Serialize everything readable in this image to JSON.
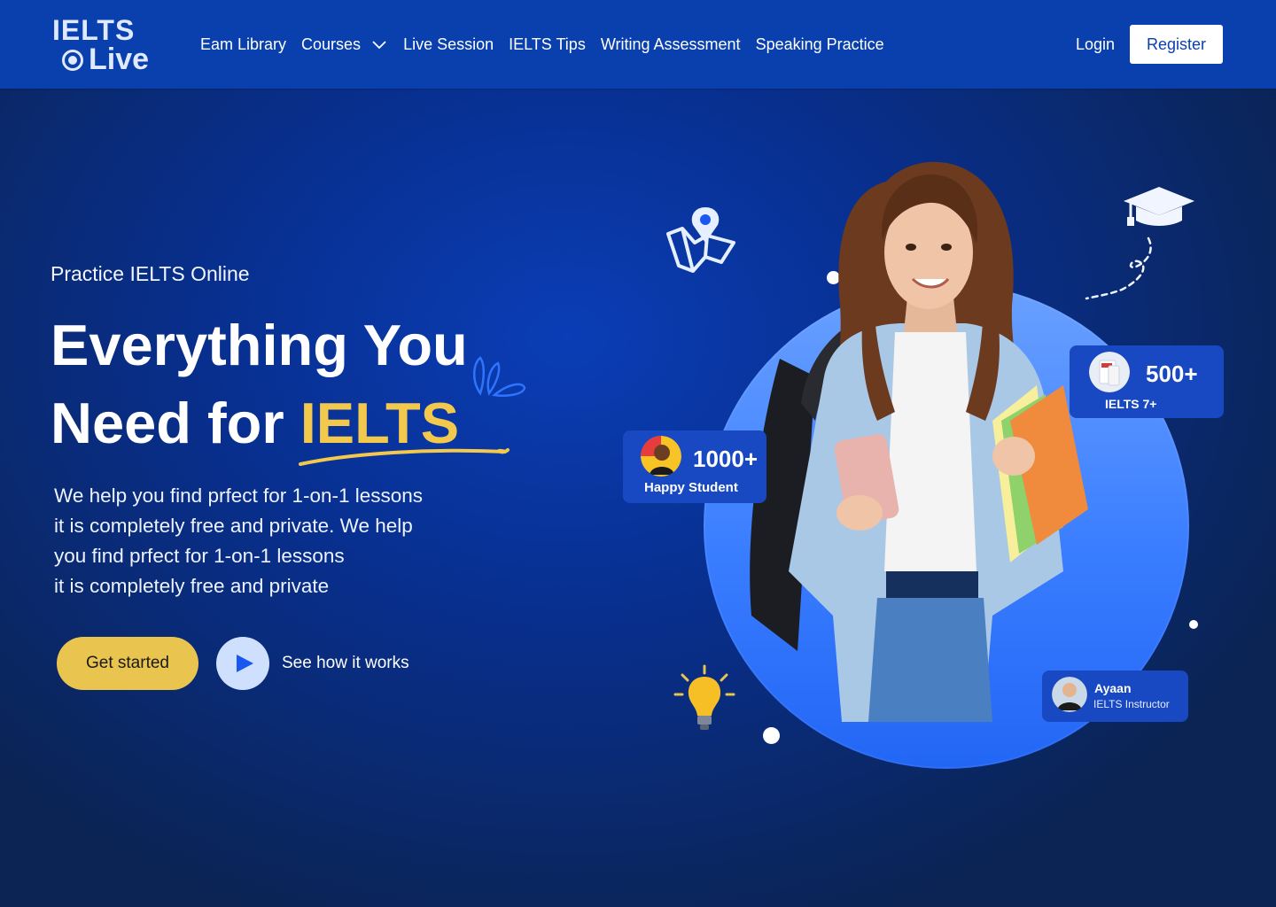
{
  "brand": {
    "logo_top": "IELTS",
    "logo_bottom": "Live"
  },
  "nav": {
    "links": [
      {
        "label": "Eam Library"
      },
      {
        "label": "Courses"
      },
      {
        "label": "Live Session"
      },
      {
        "label": "IELTS Tips"
      },
      {
        "label": "Writing Assessment"
      },
      {
        "label": "Speaking Practice"
      }
    ],
    "login_label": "Login",
    "register_label": "Register"
  },
  "hero": {
    "eyebrow": "Practice IELTS Online",
    "headline_line1": "Everything You",
    "headline_line2_prefix": "Need for ",
    "headline_line2_accent": "IELTS",
    "description_lines": [
      "We help you find prfect for 1-on-1 lessons",
      "it is completely free and private. We help",
      "you find prfect for 1-on-1 lessons",
      "it is completely free and private"
    ],
    "cta_primary": "Get started",
    "cta_secondary": "See how it works"
  },
  "stats": {
    "students": {
      "value": "1000+",
      "label": "Happy Student"
    },
    "ielts": {
      "value": "500+",
      "label": "IELTS 7+"
    },
    "instructor": {
      "name": "Ayaan",
      "role": "IELTS Instructor"
    }
  },
  "colors": {
    "nav_bg": "#0a3fae",
    "accent_yellow": "#f2c94c",
    "cta_yellow": "#e9c44e",
    "circle_blue": "#3a7dff",
    "card_blue": "#1848c2"
  },
  "icons": [
    "map-pin-icon",
    "graduation-cap-icon",
    "lightbulb-icon",
    "play-icon",
    "chevron-down-icon",
    "sparkle-icon"
  ]
}
